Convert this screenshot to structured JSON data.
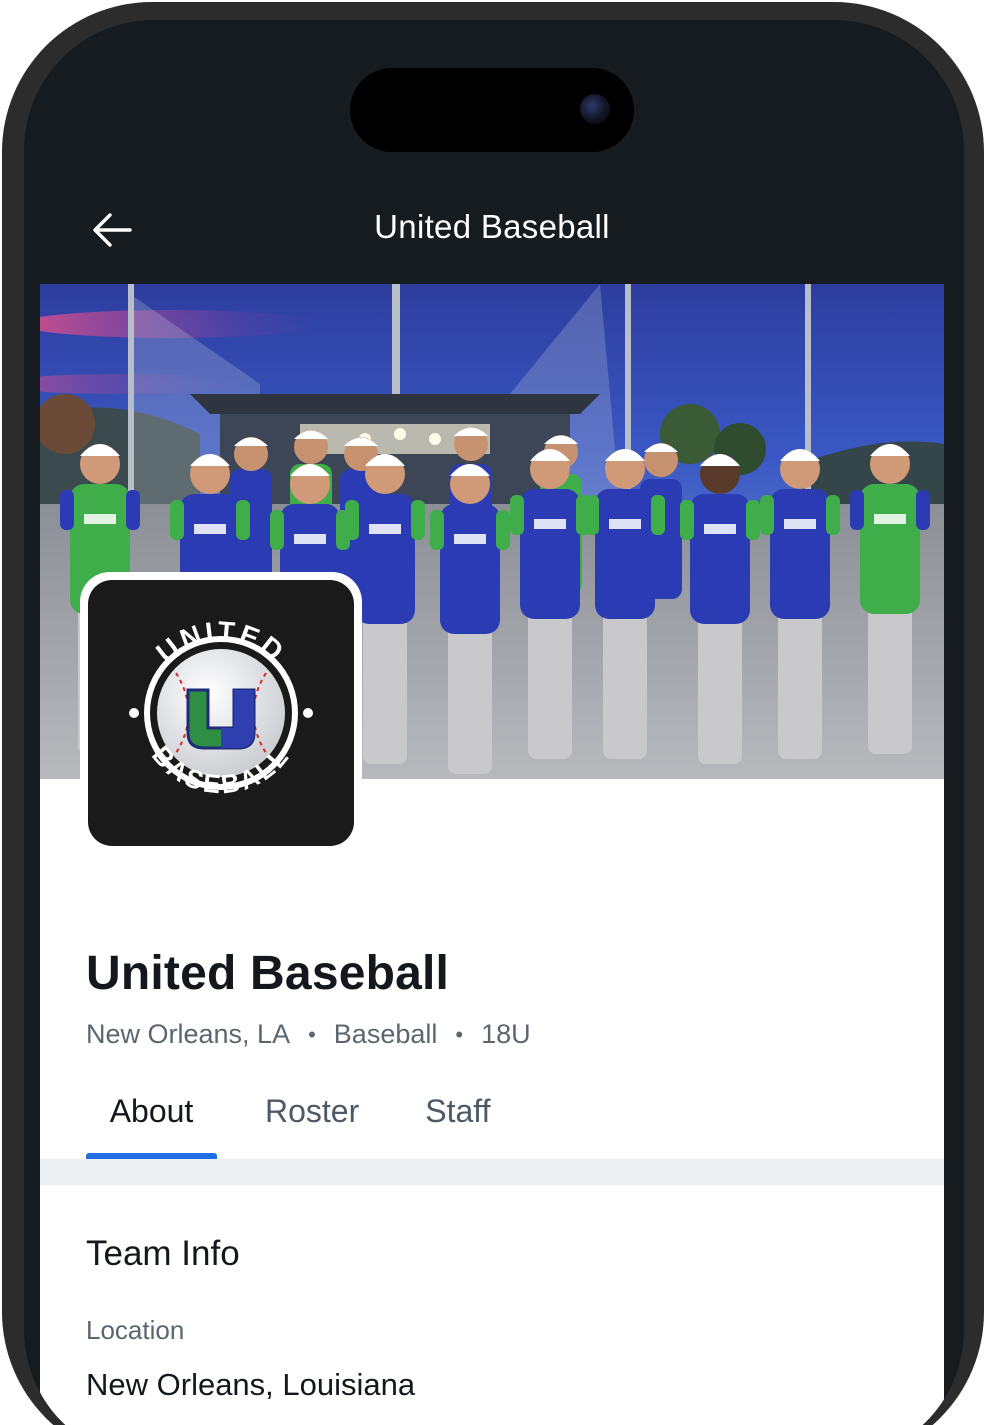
{
  "header": {
    "title": "United Baseball"
  },
  "team": {
    "name": "United Baseball",
    "location_short": "New Orleans, LA",
    "sport": "Baseball",
    "age_group": "18U",
    "separator": "•",
    "logo_text_top": "UNITED",
    "logo_text_bottom": "BASEBALL",
    "logo_letter": "U"
  },
  "tabs": [
    {
      "label": "About",
      "active": true
    },
    {
      "label": "Roster",
      "active": false
    },
    {
      "label": "Staff",
      "active": false
    }
  ],
  "team_info": {
    "section_title": "Team Info",
    "location_label": "Location",
    "location_value": "New Orleans, Louisiana"
  },
  "colors": {
    "header_bg": "#161b20",
    "accent": "#1f6fe0",
    "jersey_blue": "#2b3bb3",
    "jersey_green": "#3fae4a"
  },
  "icons": {
    "back": "arrow-left-icon"
  }
}
